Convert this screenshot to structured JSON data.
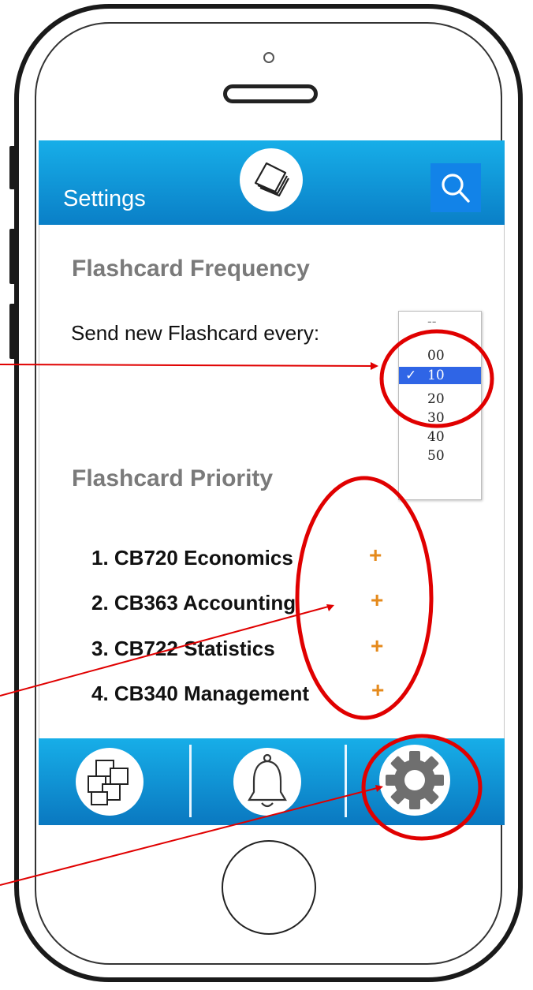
{
  "header": {
    "title": "Settings"
  },
  "frequency": {
    "heading": "Flashcard Frequency",
    "label": "Send new Flashcard every:",
    "dropdown": {
      "top": "--",
      "options": [
        "00",
        "10",
        "20",
        "30",
        "40",
        "50"
      ],
      "selected": "10",
      "check": "✓"
    }
  },
  "priority": {
    "heading": "Flashcard Priority",
    "items": [
      "1. CB720 Economics",
      "2. CB363 Accounting",
      "3. CB722 Statistics",
      "4. CB340 Management"
    ],
    "add_symbol": "+"
  },
  "colors": {
    "bar": "#0f93d6",
    "accent_plus": "#e58a1c",
    "annotation": "#e00000",
    "selected": "#2f65e6"
  },
  "icons": {
    "top": [
      "cards-logo-icon",
      "search-icon"
    ],
    "bottom": [
      "flashcards-icon",
      "bell-icon",
      "gear-icon"
    ]
  }
}
